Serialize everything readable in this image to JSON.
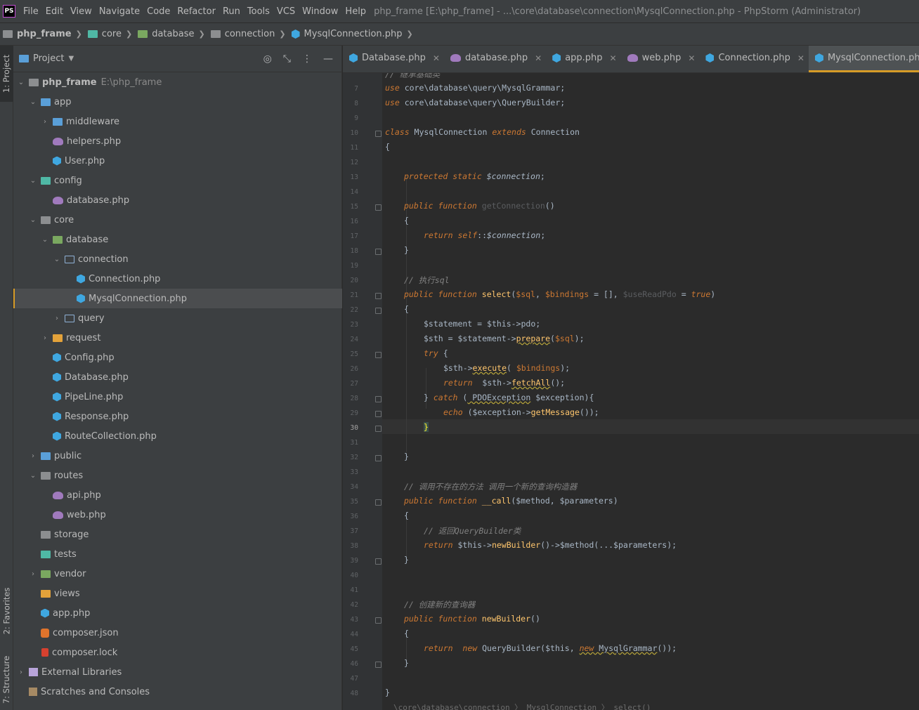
{
  "menu": {
    "logo": "PS",
    "items": [
      "File",
      "Edit",
      "View",
      "Navigate",
      "Code",
      "Refactor",
      "Run",
      "Tools",
      "VCS",
      "Window",
      "Help"
    ],
    "title": "php_frame [E:\\php_frame] - ...\\core\\database\\connection\\MysqlConnection.php - PhpStorm (Administrator)"
  },
  "breadcrumb": [
    "php_frame",
    "core",
    "database",
    "connection",
    "MysqlConnection.php"
  ],
  "side_tabs": {
    "project": "1: Project",
    "favorites": "2: Favorites",
    "structure": "7: Structure"
  },
  "project_panel": {
    "header": "Project",
    "root_name": "php_frame",
    "root_path": "E:\\php_frame",
    "items": [
      {
        "label": "app",
        "icon": "folder-blue-icon"
      },
      {
        "label": "middleware",
        "icon": "folder-blue-icon"
      },
      {
        "label": "helpers.php",
        "icon": "php-elephant-icon"
      },
      {
        "label": "User.php",
        "icon": "php-class-icon"
      },
      {
        "label": "config",
        "icon": "folder-teal-icon"
      },
      {
        "label": "database.php",
        "icon": "php-elephant-icon"
      },
      {
        "label": "core",
        "icon": "folder-gray-icon"
      },
      {
        "label": "database",
        "icon": "folder-green-icon"
      },
      {
        "label": "connection",
        "icon": "folder-outline-icon"
      },
      {
        "label": "Connection.php",
        "icon": "php-class-icon"
      },
      {
        "label": "MysqlConnection.php",
        "icon": "php-class-icon"
      },
      {
        "label": "query",
        "icon": "folder-outline-icon"
      },
      {
        "label": "request",
        "icon": "folder-orange-icon"
      },
      {
        "label": "Config.php",
        "icon": "php-class-icon"
      },
      {
        "label": "Database.php",
        "icon": "php-class-icon"
      },
      {
        "label": "PipeLine.php",
        "icon": "php-class-icon"
      },
      {
        "label": "Response.php",
        "icon": "php-class-icon"
      },
      {
        "label": "RouteCollection.php",
        "icon": "php-class-icon"
      },
      {
        "label": "public",
        "icon": "folder-blue-icon"
      },
      {
        "label": "routes",
        "icon": "folder-gray-icon"
      },
      {
        "label": "api.php",
        "icon": "php-elephant-icon"
      },
      {
        "label": "web.php",
        "icon": "php-elephant-icon"
      },
      {
        "label": "storage",
        "icon": "folder-gray-icon"
      },
      {
        "label": "tests",
        "icon": "folder-teal-icon"
      },
      {
        "label": "vendor",
        "icon": "folder-green-icon"
      },
      {
        "label": "views",
        "icon": "folder-orange-icon"
      },
      {
        "label": "app.php",
        "icon": "php-class-icon"
      },
      {
        "label": "composer.json",
        "icon": "json-icon"
      },
      {
        "label": "composer.lock",
        "icon": "lock-icon"
      },
      {
        "label": "External Libraries",
        "icon": "library-icon"
      },
      {
        "label": "Scratches and Consoles",
        "icon": "scratches-icon"
      }
    ]
  },
  "tabs": [
    {
      "label": "Database.php",
      "icon": "php-class-icon"
    },
    {
      "label": "database.php",
      "icon": "php-elephant-icon"
    },
    {
      "label": "app.php",
      "icon": "php-class-icon"
    },
    {
      "label": "web.php",
      "icon": "php-elephant-icon"
    },
    {
      "label": "Connection.php",
      "icon": "php-class-icon"
    },
    {
      "label": "MysqlConnection.php",
      "icon": "php-class-icon",
      "active": true
    },
    {
      "label": "My",
      "icon": "php-class-icon"
    }
  ],
  "editor": {
    "current_line": "30",
    "line_numbers": [
      "7",
      "8",
      "9",
      "10",
      "11",
      "12",
      "13",
      "14",
      "15",
      "16",
      "17",
      "18",
      "19",
      "20",
      "21",
      "22",
      "23",
      "24",
      "25",
      "26",
      "27",
      "28",
      "29",
      "30",
      "31",
      "32",
      "33",
      "34",
      "35",
      "36",
      "37",
      "38",
      "39",
      "40",
      "41",
      "42",
      "43",
      "44",
      "45",
      "46",
      "47",
      "48"
    ],
    "top_partial_comment": "// 继承基础类",
    "code": {
      "l7a": "use",
      "l7b": " core\\database\\query\\MysqlGrammar;",
      "l8a": "use",
      "l8b": " core\\database\\query\\QueryBuilder;",
      "l10a": "class",
      "l10b": " MysqlConnection ",
      "l10c": "extends",
      "l10d": " Connection",
      "l11": "{",
      "l13a": "protected static",
      "l13b": " $connection",
      ";": ";",
      "l15a": "public function",
      "l15b": " getConnection",
      "l15c": "()",
      "l16": "{",
      "l17a": "return",
      "l17b": " self",
      "l17c": "::",
      "l17d": "$connection",
      "l18": "}",
      "l20": "// 执行sql",
      "l21a": "public function",
      "l21b": " select",
      "l21c": "(",
      "l21d": "$sql",
      ", ": ", ",
      "l21e": "$bindings",
      " = [], ": " = [], ",
      "l21f": "$useReadPdo",
      " = ": " = ",
      "l21g": "true",
      ")": ")",
      "l22": "{",
      "l23a": "$statement",
      " = $this->pdo;": " = $this->pdo;",
      "l24a": "$sth",
      " = $statement->": " = $statement->",
      "l24b": "prepare",
      "(": "(",
      "l24c": "$sql",
      "l24d": ");",
      "l25a": "try",
      " {": " {",
      "l26a": "$sth->",
      "l26b": "execute",
      "l26c": "( ",
      "l26d": "$bindings",
      "l26e": ");",
      "l27a": "return",
      "l27b": "  $sth->",
      "l27c": "fetchAll",
      "l27d": "();",
      "l28a": "} ",
      "l28b": "catch",
      " (": " (",
      "l28c": " PDOException",
      " $exception){": " $exception){",
      "l29a": "echo",
      " ($exception->": " ($exception->",
      "l29b": "getMessage",
      "l29c": "());",
      "l30": "}",
      "l32": "}",
      "l34": "// 调用不存在的方法 调用一个新的查询构造器",
      "l35a": "public function",
      "l35b": " __call",
      "l35c": "($method, $parameters)",
      "l36": "{",
      "l37": "// 返回QueryBuilder类",
      "l38a": "return",
      "l38b": " $this->",
      "l38c": "newBuilder",
      "l38d": "()->$method(...$parameters);",
      "l39": "}",
      "l42": "// 创建新的查询器",
      "l43a": "public function",
      "l43b": " newBuilder",
      "l43c": "()",
      "l44": "{",
      "l45a": "return",
      "l45b": "  new",
      "l45c": " QueryBuilder($this, ",
      "l45d": "new",
      "l45e": " MysqlGrammar",
      "l45f": "());",
      "l46": "}",
      "l48": "}"
    },
    "bottom_breadcrumb": "\\core\\database\\connection  〉 MysqlConnection  〉 select()"
  }
}
